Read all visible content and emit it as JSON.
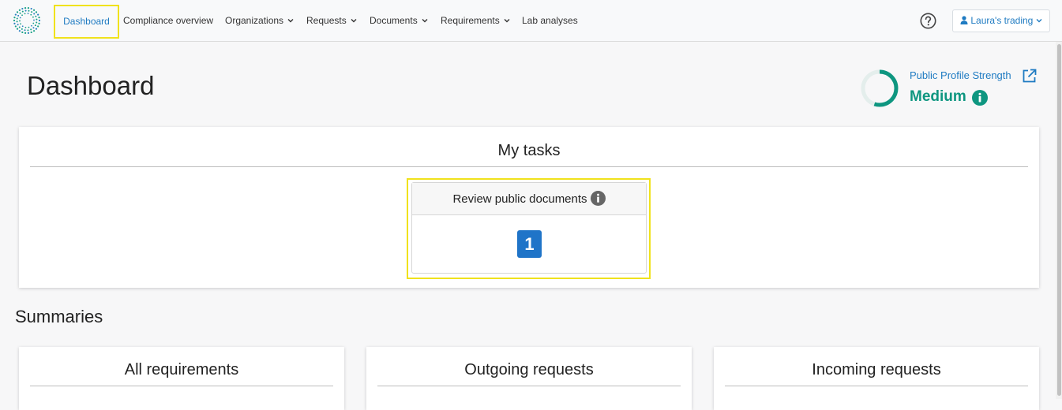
{
  "nav": {
    "active": "Dashboard",
    "items": [
      {
        "label": "Compliance overview",
        "dropdown": false
      },
      {
        "label": "Organizations",
        "dropdown": true
      },
      {
        "label": "Requests",
        "dropdown": true
      },
      {
        "label": "Documents",
        "dropdown": true
      },
      {
        "label": "Requirements",
        "dropdown": true
      },
      {
        "label": "Lab analyses",
        "dropdown": false
      }
    ],
    "org_label": "Laura's trading"
  },
  "page": {
    "title": "Dashboard"
  },
  "profile_strength": {
    "label": "Public Profile Strength",
    "value": "Medium",
    "level": 0.55,
    "color": "#0e9680"
  },
  "tasks": {
    "title": "My tasks",
    "items": [
      {
        "label": "Review public documents",
        "count": "1"
      }
    ]
  },
  "summaries": {
    "title": "Summaries",
    "cards": [
      "All requirements",
      "Outgoing requests",
      "Incoming requests"
    ]
  },
  "colors": {
    "link": "#1f7bc2",
    "accent_green": "#0e9680",
    "badge_blue": "#1f74c8",
    "highlight": "#f0e21c"
  }
}
